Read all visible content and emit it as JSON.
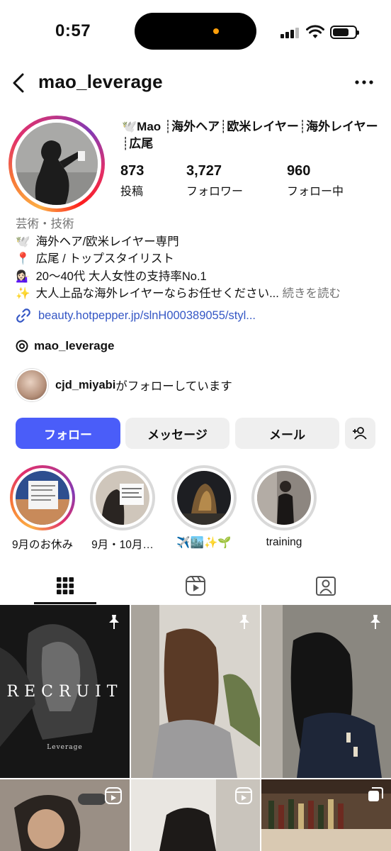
{
  "status_bar": {
    "time": "0:57"
  },
  "header": {
    "username": "mao_leverage"
  },
  "profile": {
    "name_line": "🕊️Mao ┊海外ヘア┊欧米レイヤー┊海外レイヤー┊広尾",
    "stats": [
      {
        "value": "873",
        "label": "投稿"
      },
      {
        "value": "3,727",
        "label": "フォロワー"
      },
      {
        "value": "960",
        "label": "フォロー中"
      }
    ],
    "category": "芸術・技術",
    "bio_lines": [
      {
        "emoji": "🕊️",
        "text": "海外ヘア/欧米レイヤー専門"
      },
      {
        "emoji": "📍",
        "text": "広尾 / トップスタイリスト"
      },
      {
        "emoji": "💁🏻‍♀️",
        "text": "20～40代 大人女性の支持率No.1"
      },
      {
        "emoji": "✨",
        "text": "大人上品な海外レイヤーならお任せください..."
      }
    ],
    "more_label": "続きを読む",
    "link": "beauty.hotpepper.jp/slnH000389055/styl...",
    "threads_handle": "mao_leverage",
    "followed_by_user": "cjd_miyabi",
    "followed_by_suffix": "がフォローしています"
  },
  "buttons": {
    "follow": "フォロー",
    "message": "メッセージ",
    "mail": "メール"
  },
  "highlights": [
    {
      "label": "9月のお休み"
    },
    {
      "label": "9月・10月…"
    },
    {
      "label": "✈️🏙️✨🌱"
    },
    {
      "label": "training"
    }
  ],
  "tabs": [
    "grid",
    "reels",
    "tagged"
  ],
  "posts": [
    {
      "title": "RECRUIT",
      "subtitle": "Leverage",
      "pinned": true
    },
    {
      "pinned": true
    },
    {
      "pinned": true
    },
    {
      "type": "reel"
    },
    {
      "type": "reel"
    },
    {
      "type": "carousel"
    }
  ],
  "colors": {
    "follow_button": "#4a5df9",
    "link": "#3557c5"
  }
}
